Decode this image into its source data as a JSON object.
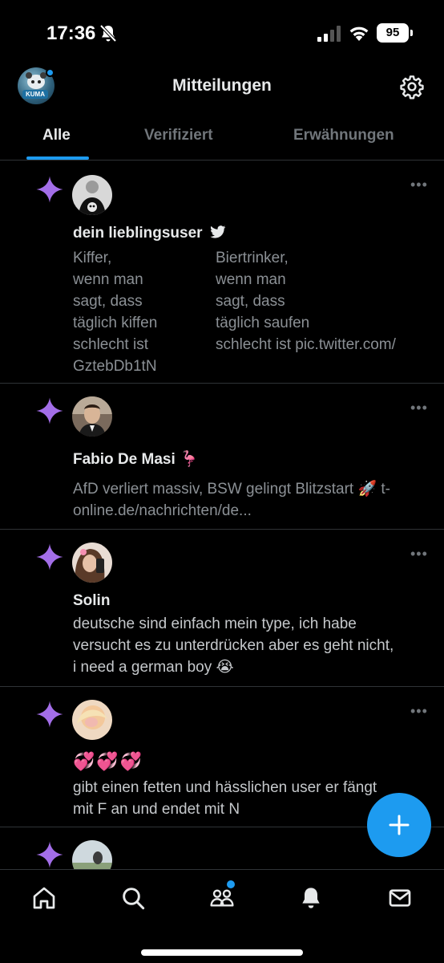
{
  "status_bar": {
    "time": "17:36",
    "battery": "95"
  },
  "header": {
    "title": "Mitteilungen",
    "profile_badge": "KUMA"
  },
  "tabs": [
    {
      "label": "Alle",
      "active": true
    },
    {
      "label": "Verifiziert",
      "active": false
    },
    {
      "label": "Erwähnungen",
      "active": false
    }
  ],
  "notifications": [
    {
      "name": "dein lieblingsuser",
      "name_badge": "twitter-bird-icon",
      "col_left": [
        "Kiffer,",
        "wenn man",
        "sagt, dass",
        "täglich kiffen",
        "schlecht ist"
      ],
      "col_right": [
        "Biertrinker,",
        "wenn man",
        "sagt, dass",
        "täglich saufen",
        "schlecht ist pic.twitter.com/"
      ],
      "tail": "GztebDb1tN"
    },
    {
      "name": "Fabio De Masi 🦩",
      "line1": "AfD verliert massiv, BSW gelingt Blitzstart 🚀 t-",
      "line2": "online.de/nachrichten/de..."
    },
    {
      "name": "Solin",
      "line1": "deutsche sind einfach mein type, ich habe",
      "line2": "versucht es zu unterdrücken aber es geht nicht,",
      "line3": "i need a german boy 😭"
    },
    {
      "name": "💞💞💞",
      "line1": "gibt einen fetten und hässlichen user er fängt",
      "line2": "mit F an und endet mit N"
    }
  ],
  "icons": {
    "notification_type": "sparkle-icon",
    "more": "more-dots-icon",
    "nav": [
      "home-icon",
      "search-icon",
      "communities-icon",
      "notifications-bell-icon",
      "messages-envelope-icon"
    ]
  },
  "colors": {
    "accent": "#1d9bf0",
    "sparkle": "#a36ee8",
    "background": "#000000",
    "divider": "#2f3336"
  }
}
